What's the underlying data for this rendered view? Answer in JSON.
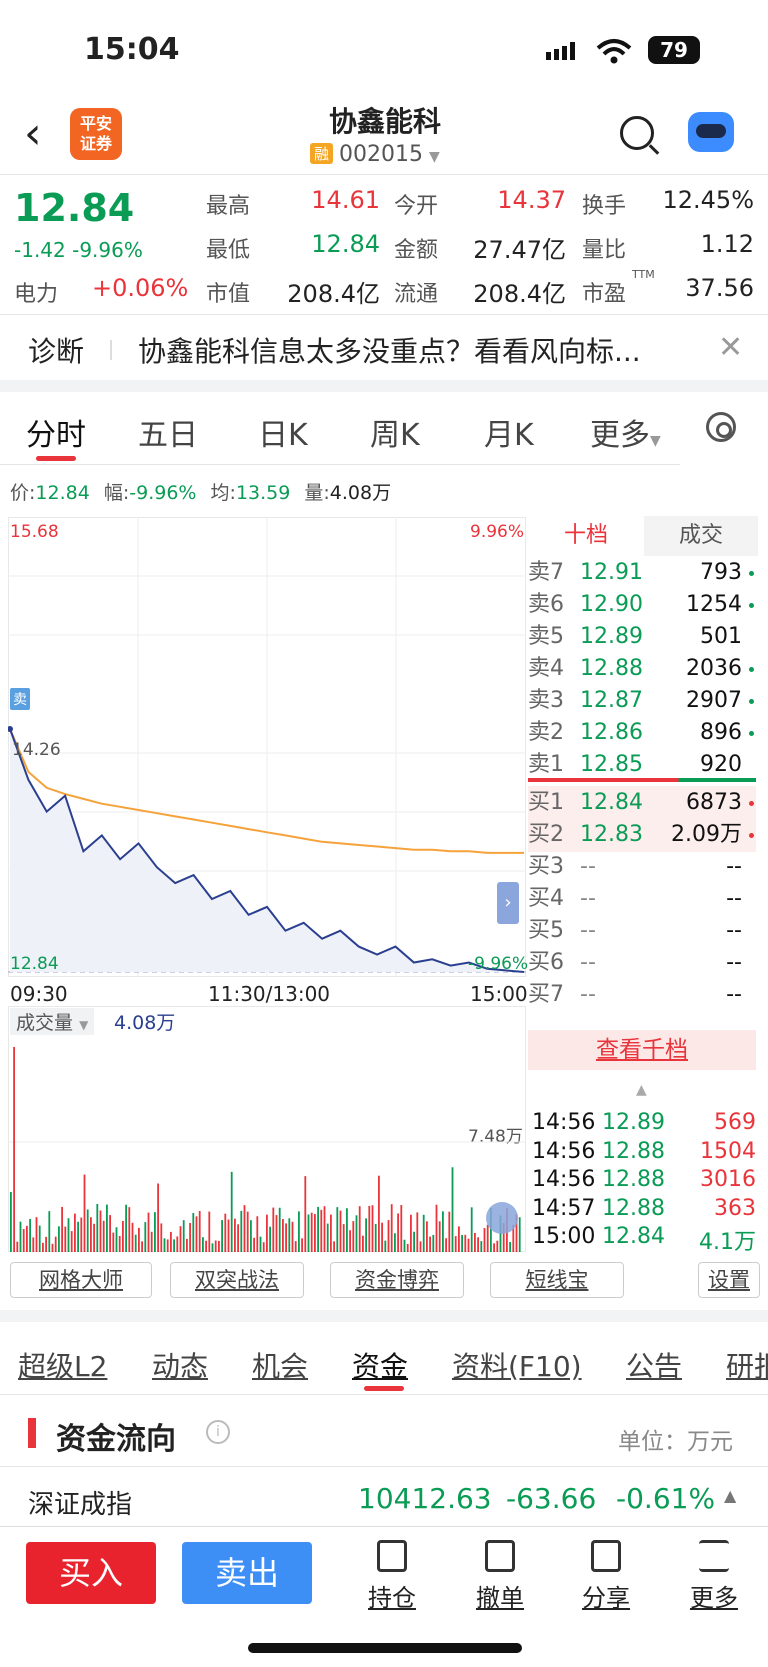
{
  "status_bar": {
    "time": "15:04",
    "battery": "79"
  },
  "header": {
    "title": "协鑫能科",
    "code": "002015",
    "rong_badge": "融",
    "broker_logo_text": "平安\n证券"
  },
  "quote": {
    "price": "12.84",
    "change": "-1.42",
    "change_pct": "-9.96%",
    "sector_name": "电力",
    "sector_pct": "+0.06%",
    "fields": [
      {
        "label": "最高",
        "value": "14.61"
      },
      {
        "label": "今开",
        "value": "14.37"
      },
      {
        "label": "换手",
        "value": "12.45%"
      },
      {
        "label": "最低",
        "value": "12.84"
      },
      {
        "label": "金额",
        "value": "27.47亿"
      },
      {
        "label": "量比",
        "value": "1.12"
      },
      {
        "label": "市值",
        "value": "208.4亿"
      },
      {
        "label": "流通",
        "value": "208.4亿"
      },
      {
        "label": "市盈",
        "value": "37.56"
      }
    ],
    "pe_superscript": "TTM"
  },
  "diagnosis": {
    "label": "诊断",
    "text": "协鑫能科信息太多没重点？看看风向标..."
  },
  "chart_tabs": [
    "分时",
    "五日",
    "日K",
    "周K",
    "月K",
    "更多"
  ],
  "info_line": {
    "price_label": "价:",
    "price": "12.84",
    "amp_label": "幅:",
    "amp": "-9.96%",
    "avg_label": "均:",
    "avg": "13.59",
    "vol_label": "量:",
    "vol": "4.08万"
  },
  "chart_labels": {
    "y_top": "15.68",
    "pct_top": "9.96%",
    "y_mid": "14.26",
    "y_bottom": "12.84",
    "pct_bottom": "-9.96%",
    "x_start": "09:30",
    "x_mid": "11:30/13:00",
    "x_end": "15:00",
    "sell_badge": "卖",
    "vol_label": "成交量",
    "vol_value": "4.08万",
    "vol_max": "7.48万"
  },
  "chart_data": {
    "type": "line",
    "x_ticks": [
      "09:30",
      "11:30/13:00",
      "15:00"
    ],
    "ylim": [
      12.84,
      15.68
    ],
    "series": [
      {
        "values": [
          14.37,
          14.05,
          13.85,
          13.95,
          13.6,
          13.7,
          13.55,
          13.65,
          13.5,
          13.4,
          13.45,
          13.3,
          13.35,
          13.2,
          13.25,
          13.1,
          13.15,
          13.05,
          13.1,
          13.0,
          12.95,
          13.0,
          12.9,
          12.92,
          12.88,
          12.9,
          12.86,
          12.85,
          12.84
        ]
      },
      {
        "values": [
          14.37,
          14.1,
          14.0,
          13.96,
          13.93,
          13.9,
          13.88,
          13.86,
          13.84,
          13.82,
          13.8,
          13.78,
          13.76,
          13.74,
          13.72,
          13.7,
          13.68,
          13.66,
          13.65,
          13.64,
          13.63,
          13.62,
          13.61,
          13.61,
          13.6,
          13.6,
          13.59,
          13.59,
          13.59
        ]
      }
    ],
    "colors": {
      "price": "#2a3f8f",
      "avg": "#f5a23a",
      "up": "#e8343a",
      "down": "#0a9b55"
    }
  },
  "order_book": {
    "tab_active": "十档",
    "tab_other": "成交",
    "asks": [
      {
        "label": "卖7",
        "price": "12.91",
        "vol": "793"
      },
      {
        "label": "卖6",
        "price": "12.90",
        "vol": "1254"
      },
      {
        "label": "卖5",
        "price": "12.89",
        "vol": "501"
      },
      {
        "label": "卖4",
        "price": "12.88",
        "vol": "2036"
      },
      {
        "label": "卖3",
        "price": "12.87",
        "vol": "2907"
      },
      {
        "label": "卖2",
        "price": "12.86",
        "vol": "896"
      },
      {
        "label": "卖1",
        "price": "12.85",
        "vol": "920"
      }
    ],
    "bids": [
      {
        "label": "买1",
        "price": "12.84",
        "vol": "6873"
      },
      {
        "label": "买2",
        "price": "12.83",
        "vol": "2.09万"
      },
      {
        "label": "买3",
        "price": "--",
        "vol": "--"
      },
      {
        "label": "买4",
        "price": "--",
        "vol": "--"
      },
      {
        "label": "买5",
        "price": "--",
        "vol": "--"
      },
      {
        "label": "买6",
        "price": "--",
        "vol": "--"
      },
      {
        "label": "买7",
        "price": "--",
        "vol": "--"
      }
    ],
    "more_link": "查看千档"
  },
  "trades": [
    {
      "time": "14:56",
      "price": "12.89",
      "vol": "569"
    },
    {
      "time": "14:56",
      "price": "12.88",
      "vol": "1504"
    },
    {
      "time": "14:56",
      "price": "12.88",
      "vol": "3016"
    },
    {
      "time": "14:57",
      "price": "12.88",
      "vol": "363"
    },
    {
      "time": "15:00",
      "price": "12.84",
      "vol": "4.1万"
    }
  ],
  "tools": [
    "网格大师",
    "双突战法",
    "资金博弈",
    "短线宝",
    "设置"
  ],
  "sections": [
    "超级L2",
    "动态",
    "机会",
    "资金",
    "资料(F10)",
    "公告",
    "研报"
  ],
  "fund_flow": {
    "title": "资金流向",
    "unit": "单位：万元",
    "index_name": "深证成指",
    "index_value": "10412.63",
    "index_change": "-63.66",
    "index_pct": "-0.61%"
  },
  "bottom_bar": {
    "buy": "买入",
    "sell": "卖出",
    "items": [
      "持仓",
      "撤单",
      "分享",
      "更多"
    ]
  }
}
